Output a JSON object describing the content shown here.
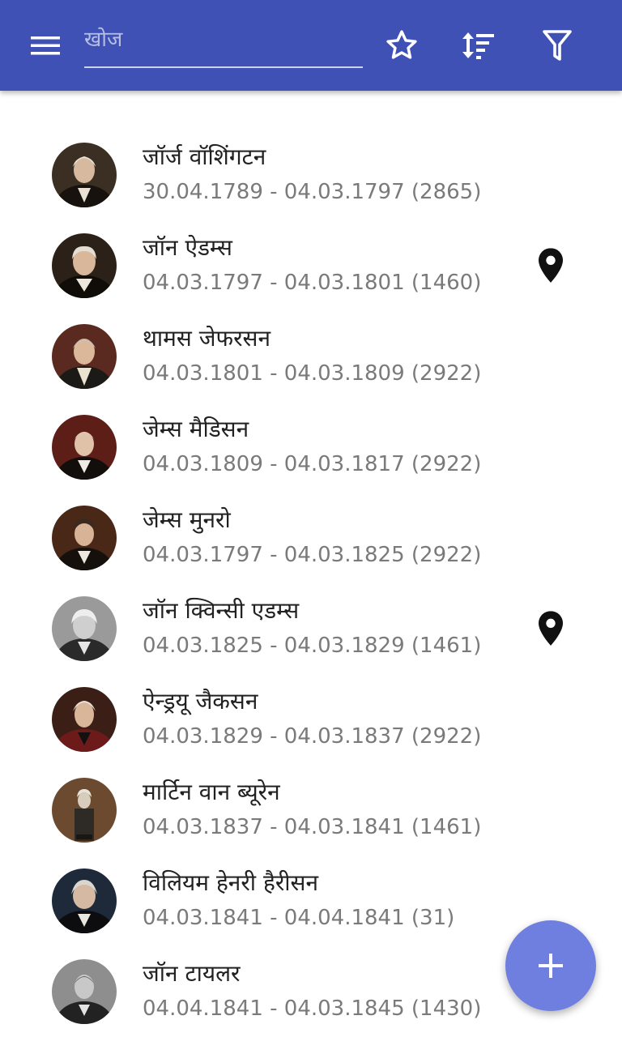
{
  "search": {
    "placeholder": "खोज",
    "value": ""
  },
  "toolbar": {
    "menu_icon": "hamburger-menu-icon",
    "favorite_icon": "star-outline-icon",
    "sort_icon": "sort-icon",
    "filter_icon": "filter-icon"
  },
  "colors": {
    "appbar": "#3f51b5",
    "fab": "#6f7fe0",
    "primary_text": "#212121",
    "secondary_text": "#7a7a7a"
  },
  "presidents": [
    {
      "name": "जॉर्ज वॉशिंगटन",
      "dates": "30.04.1789 - 04.03.1797 (2865)",
      "pinned": false
    },
    {
      "name": "जॉन ऐडम्स",
      "dates": "04.03.1797 - 04.03.1801 (1460)",
      "pinned": true
    },
    {
      "name": "थामस जेफरसन",
      "dates": "04.03.1801 - 04.03.1809 (2922)",
      "pinned": false
    },
    {
      "name": "जेम्स मैडिसन",
      "dates": "04.03.1809 - 04.03.1817 (2922)",
      "pinned": false
    },
    {
      "name": "जेम्स मुनरो",
      "dates": "04.03.1797 - 04.03.1825 (2922)",
      "pinned": false
    },
    {
      "name": "जॉन क्विन्सी एडम्स",
      "dates": "04.03.1825 - 04.03.1829 (1461)",
      "pinned": true
    },
    {
      "name": "ऐन्ड्रयू जैकसन",
      "dates": "04.03.1829 - 04.03.1837 (2922)",
      "pinned": false
    },
    {
      "name": "मार्टिन वान ब्यूरेन",
      "dates": "04.03.1837 - 04.03.1841 (1461)",
      "pinned": false
    },
    {
      "name": "विलियम हेनरी हैरीसन",
      "dates": "04.03.1841 - 04.04.1841 (31)",
      "pinned": false
    },
    {
      "name": "जॉन टायलर",
      "dates": "04.04.1841 - 04.03.1845 (1430)",
      "pinned": false
    }
  ],
  "fab": {
    "icon": "plus-icon"
  }
}
